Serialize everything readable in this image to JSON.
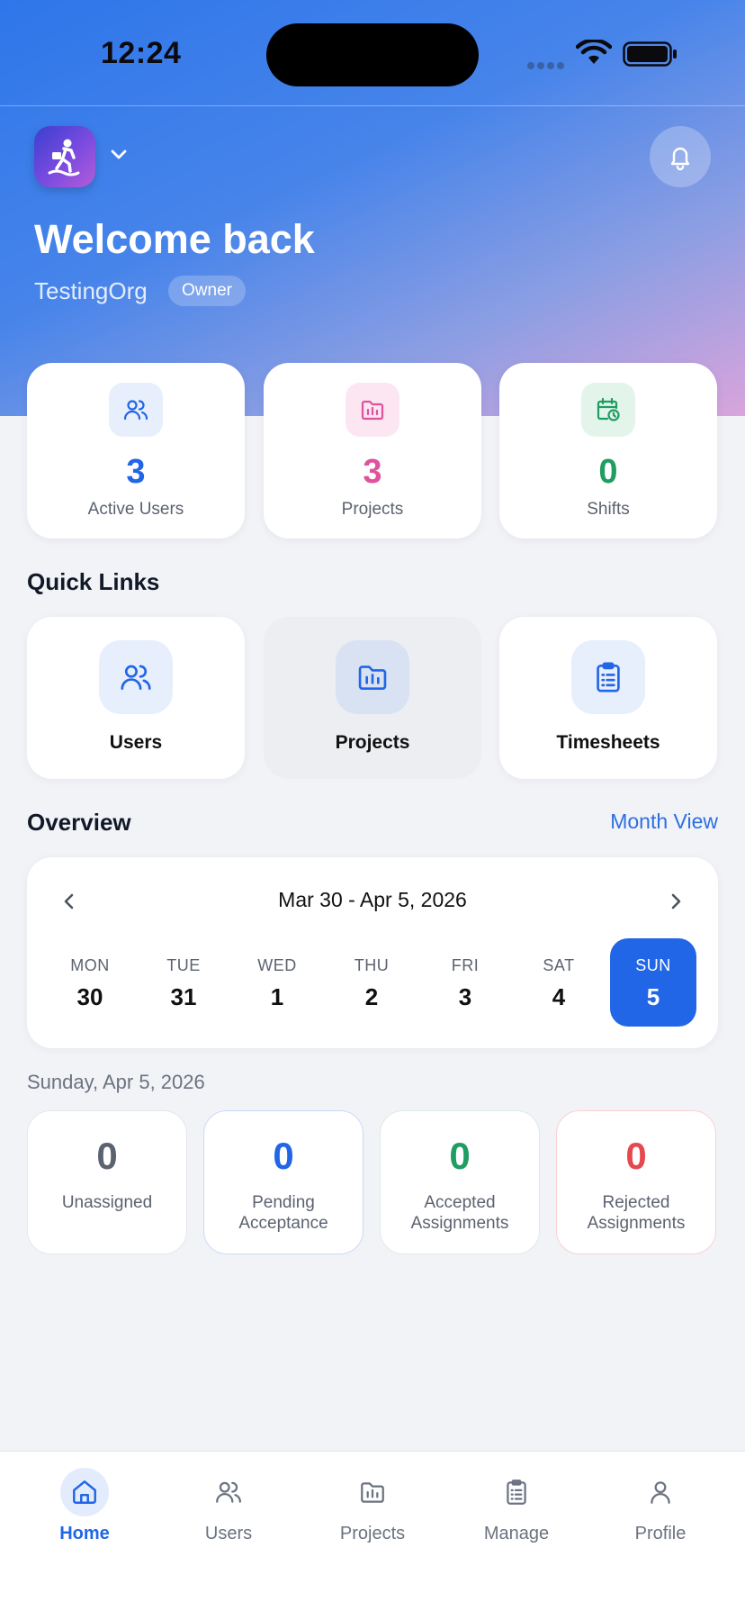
{
  "status_bar": {
    "time": "12:24"
  },
  "header": {
    "welcome": "Welcome back",
    "org_name": "TestingOrg",
    "role_badge": "Owner"
  },
  "stats": [
    {
      "value": "3",
      "label": "Active Users",
      "color": "#2166e6",
      "icon": "users-icon"
    },
    {
      "value": "3",
      "label": "Projects",
      "color": "#e0529d",
      "icon": "folder-chart-icon"
    },
    {
      "value": "0",
      "label": "Shifts",
      "color": "#1f9d63",
      "icon": "calendar-clock-icon"
    }
  ],
  "quick_links": {
    "title": "Quick Links",
    "items": [
      {
        "label": "Users",
        "icon": "users-icon"
      },
      {
        "label": "Projects",
        "icon": "folder-chart-icon"
      },
      {
        "label": "Timesheets",
        "icon": "clipboard-icon"
      }
    ]
  },
  "overview": {
    "title": "Overview",
    "month_view": "Month View",
    "range": "Mar 30 - Apr 5, 2026",
    "days": [
      {
        "name": "MON",
        "num": "30"
      },
      {
        "name": "TUE",
        "num": "31"
      },
      {
        "name": "WED",
        "num": "1"
      },
      {
        "name": "THU",
        "num": "2"
      },
      {
        "name": "FRI",
        "num": "3"
      },
      {
        "name": "SAT",
        "num": "4"
      },
      {
        "name": "SUN",
        "num": "5"
      }
    ],
    "selected_day": "SUN",
    "selected_date": "Sunday, Apr 5, 2026"
  },
  "assignments": [
    {
      "value": "0",
      "label": "Unassigned",
      "color": "#5b6270"
    },
    {
      "value": "0",
      "label": "Pending Acceptance",
      "color": "#2166e6"
    },
    {
      "value": "0",
      "label": "Accepted Assignments",
      "color": "#1f9d63"
    },
    {
      "value": "0",
      "label": "Rejected Assignments",
      "color": "#e5484d"
    }
  ],
  "tab_bar": {
    "active": "Home",
    "items": [
      {
        "label": "Home",
        "icon": "home-icon"
      },
      {
        "label": "Users",
        "icon": "users-icon"
      },
      {
        "label": "Projects",
        "icon": "folder-chart-icon"
      },
      {
        "label": "Manage",
        "icon": "clipboard-icon"
      },
      {
        "label": "Profile",
        "icon": "person-icon"
      }
    ]
  }
}
